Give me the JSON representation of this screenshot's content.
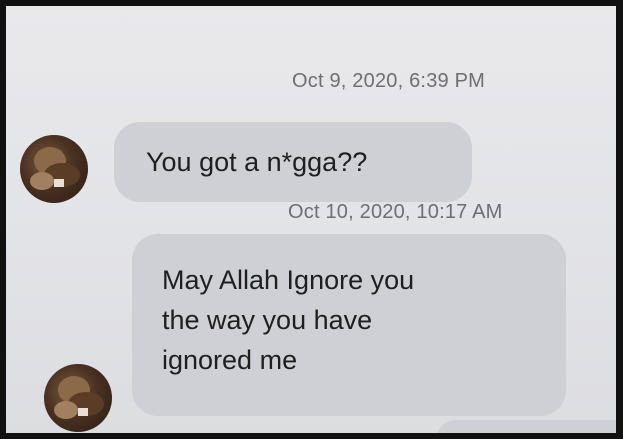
{
  "conversation": {
    "messages": [
      {
        "timestamp": "Oct 9, 2020, 6:39 PM",
        "text": "You got a n*gga??",
        "sender_avatar": "contact-avatar-photo"
      },
      {
        "timestamp": "Oct 10, 2020, 10:17 AM",
        "lines": [
          "May Allah Ignore you",
          "the way you have",
          "ignored me"
        ],
        "sender_avatar": "contact-avatar-photo"
      }
    ]
  },
  "colors": {
    "background": "#e4e5e8",
    "bubble_received": "#cfd0d5",
    "timestamp_text": "#6e6e73",
    "message_text": "#1f1f22"
  }
}
